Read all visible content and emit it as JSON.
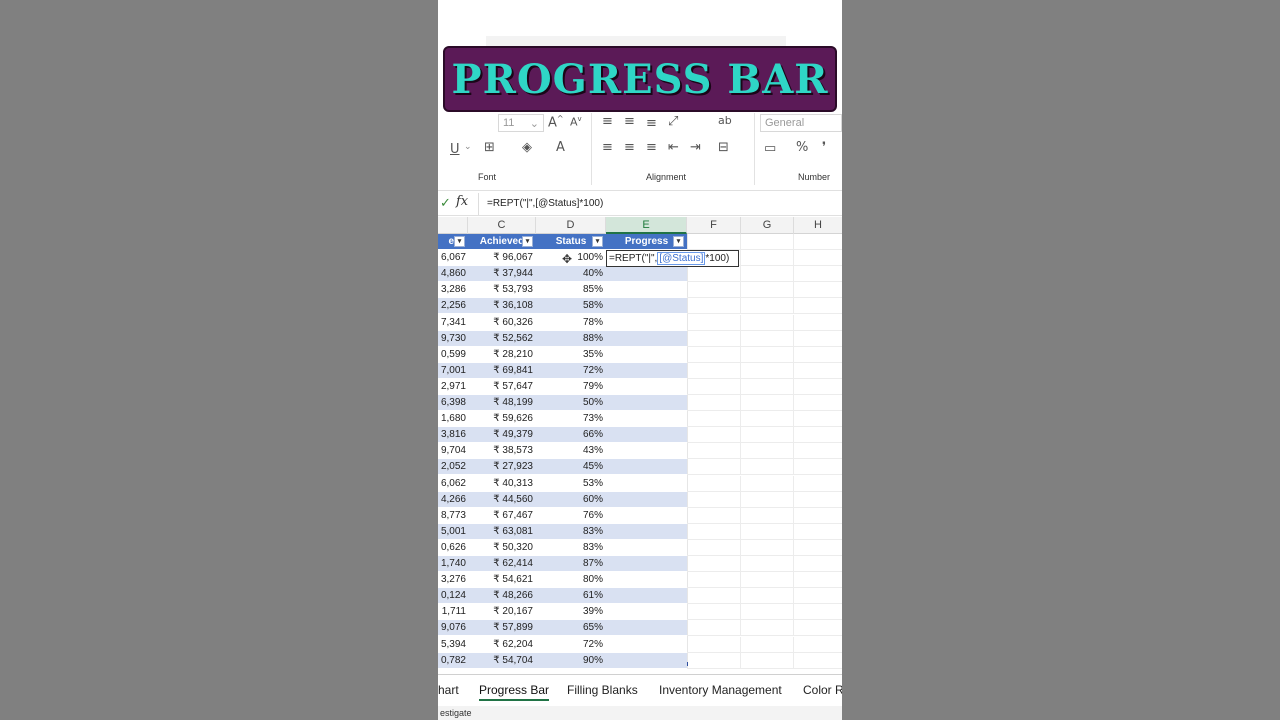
{
  "banner": {
    "title": "PROGRESS BAR"
  },
  "ribbon": {
    "font_size": "11",
    "number_format": "General",
    "font_group_label": "Font",
    "alignment_group_label": "Alignment",
    "number_group_label": "Number",
    "percent_symbol": "%"
  },
  "formula_bar": {
    "formula": "=REPT(\"|\",[@Status]*100)"
  },
  "columns": [
    "C",
    "D",
    "E",
    "F",
    "G",
    "H"
  ],
  "table_headers": {
    "target": "et",
    "achieved": "Achieved",
    "status": "Status",
    "progress": "Progress"
  },
  "editing_cell": {
    "prefix": "=REPT(\"|\",",
    "reference": "[@Status]",
    "suffix": "*100)"
  },
  "rows": [
    {
      "b": "6,067",
      "c": "₹ 96,067",
      "d": "100%"
    },
    {
      "b": "4,860",
      "c": "₹ 37,944",
      "d": "40%"
    },
    {
      "b": "3,286",
      "c": "₹ 53,793",
      "d": "85%"
    },
    {
      "b": "2,256",
      "c": "₹ 36,108",
      "d": "58%"
    },
    {
      "b": "7,341",
      "c": "₹ 60,326",
      "d": "78%"
    },
    {
      "b": "9,730",
      "c": "₹ 52,562",
      "d": "88%"
    },
    {
      "b": "0,599",
      "c": "₹ 28,210",
      "d": "35%"
    },
    {
      "b": "7,001",
      "c": "₹ 69,841",
      "d": "72%"
    },
    {
      "b": "2,971",
      "c": "₹ 57,647",
      "d": "79%"
    },
    {
      "b": "6,398",
      "c": "₹ 48,199",
      "d": "50%"
    },
    {
      "b": "1,680",
      "c": "₹ 59,626",
      "d": "73%"
    },
    {
      "b": "3,816",
      "c": "₹ 49,379",
      "d": "66%"
    },
    {
      "b": "9,704",
      "c": "₹ 38,573",
      "d": "43%"
    },
    {
      "b": "2,052",
      "c": "₹ 27,923",
      "d": "45%"
    },
    {
      "b": "6,062",
      "c": "₹ 40,313",
      "d": "53%"
    },
    {
      "b": "4,266",
      "c": "₹ 44,560",
      "d": "60%"
    },
    {
      "b": "8,773",
      "c": "₹ 67,467",
      "d": "76%"
    },
    {
      "b": "5,001",
      "c": "₹ 63,081",
      "d": "83%"
    },
    {
      "b": "0,626",
      "c": "₹ 50,320",
      "d": "83%"
    },
    {
      "b": "1,740",
      "c": "₹ 62,414",
      "d": "87%"
    },
    {
      "b": "3,276",
      "c": "₹ 54,621",
      "d": "80%"
    },
    {
      "b": "0,124",
      "c": "₹ 48,266",
      "d": "61%"
    },
    {
      "b": "1,711",
      "c": "₹ 20,167",
      "d": "39%"
    },
    {
      "b": "9,076",
      "c": "₹ 57,899",
      "d": "65%"
    },
    {
      "b": "5,394",
      "c": "₹ 62,204",
      "d": "72%"
    },
    {
      "b": "0,782",
      "c": "₹ 54,704",
      "d": "90%"
    }
  ],
  "sheet_tabs": [
    "hart",
    "Progress Bar",
    "Filling Blanks",
    "Inventory Management",
    "Color R"
  ],
  "active_tab_index": 1,
  "status_bar": {
    "text": "estigate"
  },
  "colors": {
    "banner_bg": "#5b1a57",
    "banner_text": "#2fd6c6",
    "table_header": "#4472c4",
    "band": "#d9e1f2",
    "excel_green": "#217346"
  }
}
